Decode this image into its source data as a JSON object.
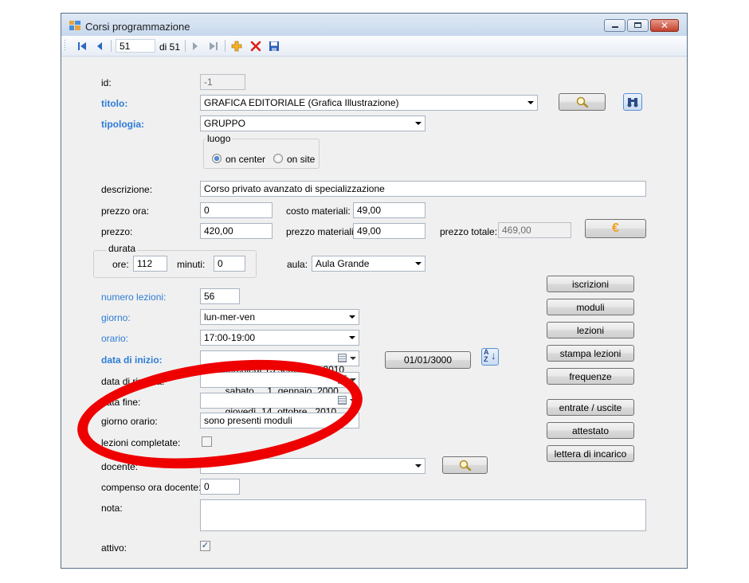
{
  "window": {
    "title": "Corsi programmazione"
  },
  "toolbar": {
    "position": "51",
    "of_label": "di 51"
  },
  "fields": {
    "id_label": "id:",
    "id_value": "-1",
    "titolo_label": "titolo:",
    "titolo_value": "GRAFICA EDITORIALE (Grafica Illustrazione)",
    "tipologia_label": "tipologia:",
    "tipologia_value": "GRUPPO",
    "luogo_title": "luogo",
    "luogo_option_center": "on center",
    "luogo_option_site": "on site",
    "descrizione_label": "descrizione:",
    "descrizione_value": "Corso privato avanzato di specializzazione",
    "prezzo_ora_label": "prezzo ora:",
    "prezzo_ora_value": "0",
    "costo_materiali_label": "costo materiali:",
    "costo_materiali_value": "49,00",
    "prezzo_label": "prezzo:",
    "prezzo_value": "420,00",
    "prezzo_materiali_label": "prezzo materiali:",
    "prezzo_materiali_value": "49,00",
    "prezzo_totale_label": "prezzo totale:",
    "prezzo_totale_value": "469,00",
    "durata_title": "durata",
    "ore_label": "ore:",
    "ore_value": "112",
    "minuti_label": "minuti:",
    "minuti_value": "0",
    "aula_label": "aula:",
    "aula_value": "Aula Grande",
    "numero_lezioni_label": "numero lezioni:",
    "numero_lezioni_value": "56",
    "giorno_label": "giorno:",
    "giorno_value": "lun-mer-ven",
    "orario_label": "orario:",
    "orario_value": "17:00-19:00",
    "data_inizio_label": "data di inizio:",
    "data_inizio_value": "mercoledì 15 settembre 2010",
    "data_ripresa_label": "data di ripresa:",
    "data_ripresa_value": "  sabato     1  gennaio  2000",
    "data_fine_label": "data fine:",
    "data_fine_value": "  giovedì  14  ottobre   2010",
    "giorno_orario_label": "giorno orario:",
    "giorno_orario_value": "sono presenti moduli",
    "lezioni_completate_label": "lezioni completate:",
    "docente_label": "docente:",
    "docente_value": "",
    "compenso_label": "compenso ora docente:",
    "compenso_value": "0",
    "nota_label": "nota:",
    "nota_value": "",
    "attivo_label": "attivo:"
  },
  "buttons": {
    "date_button": "01/01/3000",
    "iscrizioni": "iscrizioni",
    "moduli": "moduli",
    "lezioni": "lezioni",
    "stampa_lezioni": "stampa lezioni",
    "frequenze": "frequenze",
    "entrate_uscite": "entrate / uscite",
    "attestato": "attestato",
    "lettera_incarico": "lettera di incarico",
    "euro_symbol": "€",
    "sort_az_top": "A",
    "sort_az_bottom": "Z"
  },
  "state": {
    "luogo_selected": "on center",
    "lezioni_completate": false,
    "attivo": true
  },
  "colors": {
    "label_blue": "#2e7cd6",
    "annotation_red": "#ee0000"
  }
}
